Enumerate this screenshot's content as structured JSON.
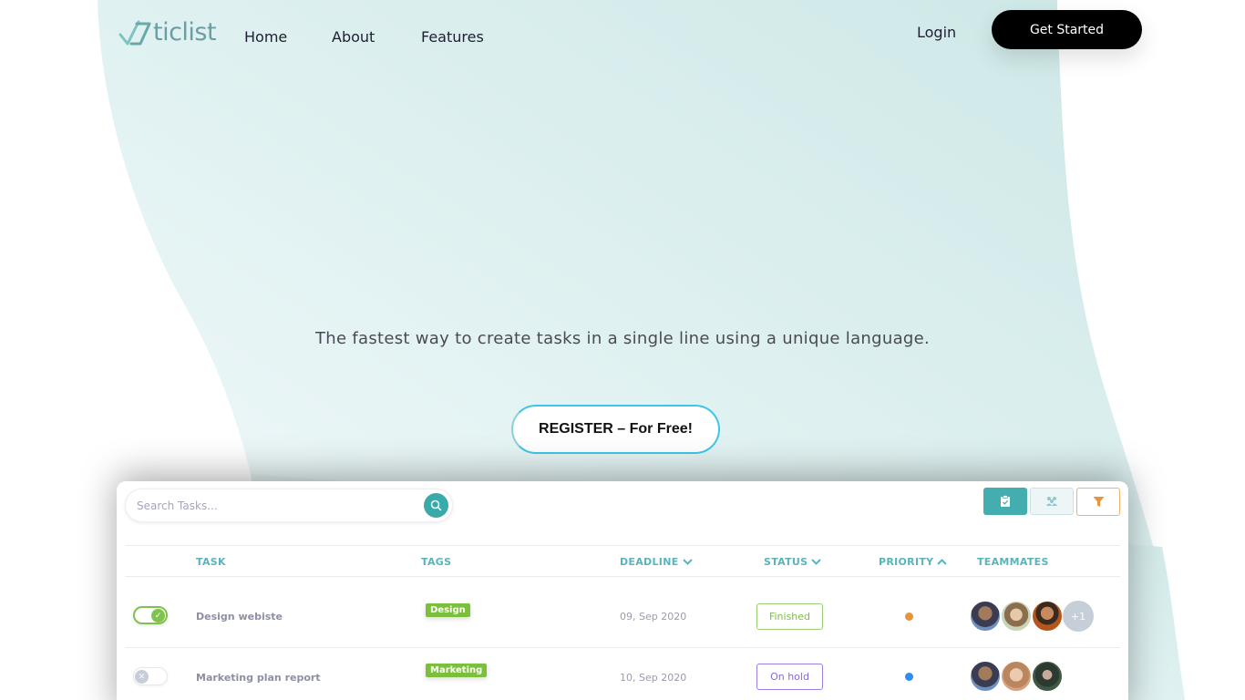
{
  "brand": {
    "name": "ticlist",
    "logo_icon": "double-check-logo-icon",
    "colors": {
      "logo": "#6a9ea4",
      "accent_teal": "#43adb0",
      "wave_background": "#d4ecea",
      "cta_border": "#3fc6e6"
    }
  },
  "nav": {
    "items": [
      {
        "label": "Home"
      },
      {
        "label": "About"
      },
      {
        "label": "Features"
      }
    ],
    "login_label": "Login",
    "get_started_label": "Get Started"
  },
  "hero": {
    "tagline": "The fastest way to create tasks in a single line using a unique language.",
    "register_label": "REGISTER – For Free!"
  },
  "preview": {
    "search": {
      "placeholder": "Search Tasks...",
      "value": "",
      "icon": "search-icon"
    },
    "view_buttons": [
      {
        "name": "tasks-view",
        "icon": "clipboard-check-icon",
        "active": true
      },
      {
        "name": "team-view",
        "icon": "team-icon",
        "active": false
      },
      {
        "name": "filter",
        "icon": "filter-icon",
        "active": false
      }
    ],
    "columns": [
      {
        "label": "TASK",
        "sort": null
      },
      {
        "label": "TAGS",
        "sort": null
      },
      {
        "label": "DEADLINE",
        "sort": "down"
      },
      {
        "label": "STATUS",
        "sort": "down"
      },
      {
        "label": "PRIORITY",
        "sort": "up"
      },
      {
        "label": "TEAMMATES",
        "sort": null
      }
    ],
    "rows": [
      {
        "done": true,
        "task": "Design webiste",
        "tag": "Design",
        "deadline": "09, Sep 2020",
        "status": "Finished",
        "priority_color": "#e8943a",
        "teammates": [
          "teammate-1",
          "teammate-2",
          "teammate-3"
        ],
        "extra_teammates": "+1"
      },
      {
        "done": false,
        "task": "Marketing plan report",
        "tag": "Marketing",
        "deadline": "10, Sep 2020",
        "status": "On hold",
        "priority_color": "#2b8ef0",
        "teammates": [
          "teammate-1",
          "teammate-4",
          "teammate-5"
        ],
        "extra_teammates": null
      }
    ]
  }
}
